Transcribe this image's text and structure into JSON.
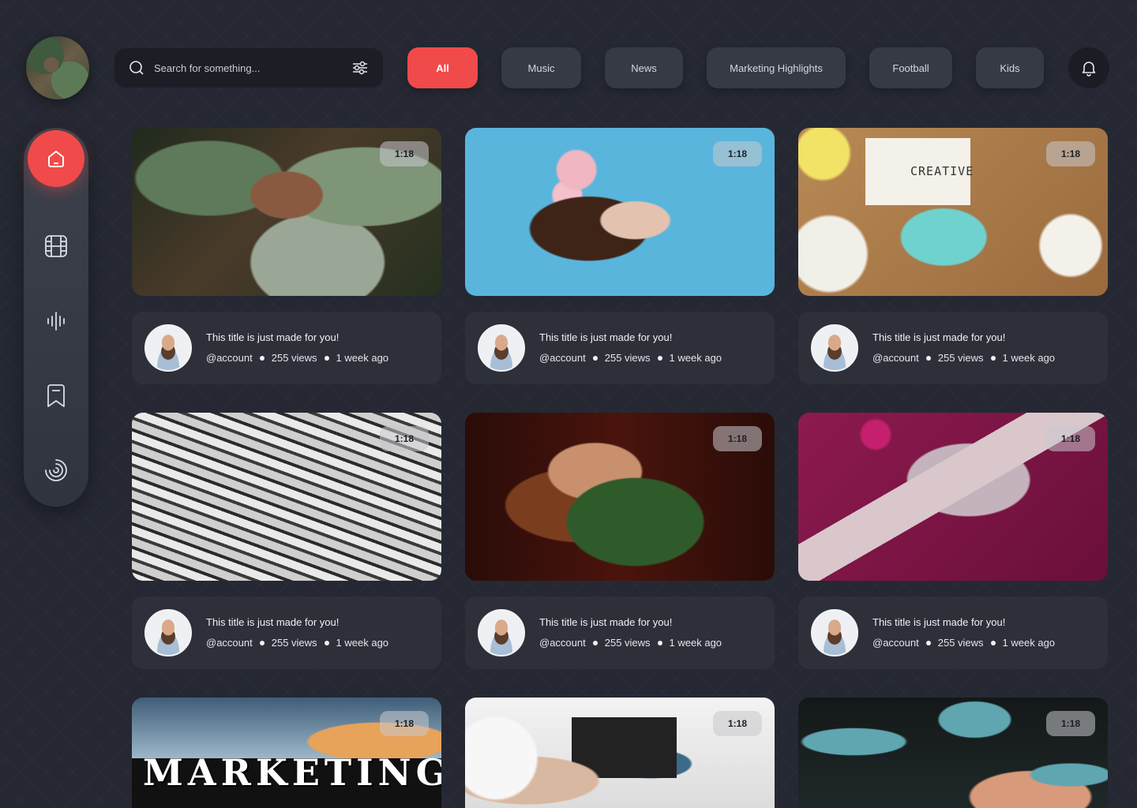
{
  "search": {
    "placeholder": "Search for something..."
  },
  "filters": [
    {
      "label": "All",
      "active": true
    },
    {
      "label": "Music",
      "active": false
    },
    {
      "label": "News",
      "active": false
    },
    {
      "label": "Marketing Highlights",
      "active": false
    },
    {
      "label": "Football",
      "active": false
    },
    {
      "label": "Kids",
      "active": false
    }
  ],
  "sidebar": {
    "items": [
      {
        "icon": "home-icon",
        "active": true
      },
      {
        "icon": "film-icon",
        "active": false
      },
      {
        "icon": "audio-wave-icon",
        "active": false
      },
      {
        "icon": "bookmark-icon",
        "active": false
      },
      {
        "icon": "spinner-icon",
        "active": false
      }
    ]
  },
  "colors": {
    "accent": "#f04a4a",
    "background": "#252832",
    "card": "#2d3039"
  },
  "thumb_text": {
    "t3": "CREATIVE",
    "t7": "MARKETING"
  },
  "videos": [
    {
      "duration": "1:18",
      "title": "This title is just made for you!",
      "account": "@account",
      "views": "255 views",
      "age": "1 week ago"
    },
    {
      "duration": "1:18",
      "title": "This title is just made for you!",
      "account": "@account",
      "views": "255 views",
      "age": "1 week ago"
    },
    {
      "duration": "1:18",
      "title": "This title is just made for you!",
      "account": "@account",
      "views": "255 views",
      "age": "1 week ago"
    },
    {
      "duration": "1:18",
      "title": "This title is just made for you!",
      "account": "@account",
      "views": "255 views",
      "age": "1 week ago"
    },
    {
      "duration": "1:18",
      "title": "This title is just made for you!",
      "account": "@account",
      "views": "255 views",
      "age": "1 week ago"
    },
    {
      "duration": "1:18",
      "title": "This title is just made for you!",
      "account": "@account",
      "views": "255 views",
      "age": "1 week ago"
    },
    {
      "duration": "1:18"
    },
    {
      "duration": "1:18"
    },
    {
      "duration": "1:18"
    }
  ]
}
